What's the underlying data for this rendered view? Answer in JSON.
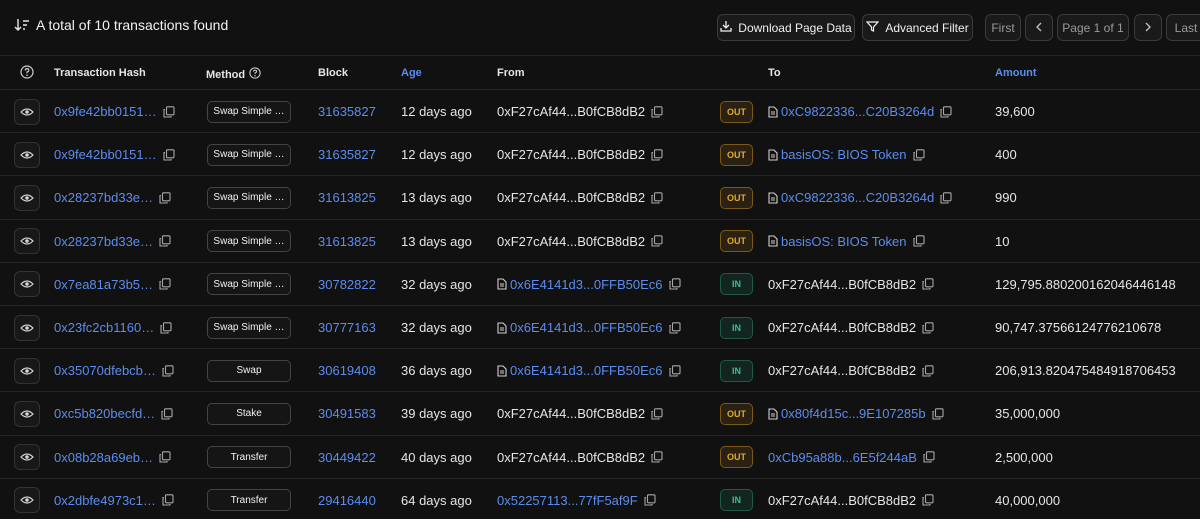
{
  "toolbar": {
    "summary": "A total of 10 transactions found",
    "download_label": "Download Page Data",
    "filter_label": "Advanced Filter",
    "first_label": "First",
    "page_label": "Page 1 of 1",
    "last_label": "Last"
  },
  "columns": {
    "hash": "Transaction Hash",
    "method": "Method",
    "block": "Block",
    "age": "Age",
    "from": "From",
    "to": "To",
    "amount": "Amount"
  },
  "rows": [
    {
      "hash": "0x9fe42bb0151…",
      "method": "Swap Simple …",
      "block": "31635827",
      "age": "12 days ago",
      "from": "0xF27cAf44...B0fCB8dB2",
      "from_contract": false,
      "from_link": false,
      "direction": "OUT",
      "to": "0xC9822336...C20B3264d",
      "to_contract": true,
      "to_link": true,
      "amount": "39,600"
    },
    {
      "hash": "0x9fe42bb0151…",
      "method": "Swap Simple …",
      "block": "31635827",
      "age": "12 days ago",
      "from": "0xF27cAf44...B0fCB8dB2",
      "from_contract": false,
      "from_link": false,
      "direction": "OUT",
      "to": "basisOS: BIOS Token",
      "to_contract": true,
      "to_link": true,
      "amount": "400"
    },
    {
      "hash": "0x28237bd33e…",
      "method": "Swap Simple …",
      "block": "31613825",
      "age": "13 days ago",
      "from": "0xF27cAf44...B0fCB8dB2",
      "from_contract": false,
      "from_link": false,
      "direction": "OUT",
      "to": "0xC9822336...C20B3264d",
      "to_contract": true,
      "to_link": true,
      "amount": "990"
    },
    {
      "hash": "0x28237bd33e…",
      "method": "Swap Simple …",
      "block": "31613825",
      "age": "13 days ago",
      "from": "0xF27cAf44...B0fCB8dB2",
      "from_contract": false,
      "from_link": false,
      "direction": "OUT",
      "to": "basisOS: BIOS Token",
      "to_contract": true,
      "to_link": true,
      "amount": "10"
    },
    {
      "hash": "0x7ea81a73b5…",
      "method": "Swap Simple …",
      "block": "30782822",
      "age": "32 days ago",
      "from": "0x6E4141d3...0FFB50Ec6",
      "from_contract": true,
      "from_link": true,
      "direction": "IN",
      "to": "0xF27cAf44...B0fCB8dB2",
      "to_contract": false,
      "to_link": false,
      "amount": "129,795.880200162046446148"
    },
    {
      "hash": "0x23fc2cb1160…",
      "method": "Swap Simple …",
      "block": "30777163",
      "age": "32 days ago",
      "from": "0x6E4141d3...0FFB50Ec6",
      "from_contract": true,
      "from_link": true,
      "direction": "IN",
      "to": "0xF27cAf44...B0fCB8dB2",
      "to_contract": false,
      "to_link": false,
      "amount": "90,747.37566124776210678"
    },
    {
      "hash": "0x35070dfebcb…",
      "method": "Swap",
      "block": "30619408",
      "age": "36 days ago",
      "from": "0x6E4141d3...0FFB50Ec6",
      "from_contract": true,
      "from_link": true,
      "direction": "IN",
      "to": "0xF27cAf44...B0fCB8dB2",
      "to_contract": false,
      "to_link": false,
      "amount": "206,913.820475484918706453"
    },
    {
      "hash": "0xc5b820becfd…",
      "method": "Stake",
      "block": "30491583",
      "age": "39 days ago",
      "from": "0xF27cAf44...B0fCB8dB2",
      "from_contract": false,
      "from_link": false,
      "direction": "OUT",
      "to": "0x80f4d15c...9E107285b",
      "to_contract": true,
      "to_link": true,
      "amount": "35,000,000"
    },
    {
      "hash": "0x08b28a69eb…",
      "method": "Transfer",
      "block": "30449422",
      "age": "40 days ago",
      "from": "0xF27cAf44...B0fCB8dB2",
      "from_contract": false,
      "from_link": false,
      "direction": "OUT",
      "to": "0xCb95a88b...6E5f244aB",
      "to_contract": false,
      "to_link": true,
      "amount": "2,500,000"
    },
    {
      "hash": "0x2dbfe4973c1…",
      "method": "Transfer",
      "block": "29416440",
      "age": "64 days ago",
      "from": "0x52257113...77fF5af9F",
      "from_contract": false,
      "from_link": true,
      "direction": "IN",
      "to": "0xF27cAf44...B0fCB8dB2",
      "to_contract": false,
      "to_link": false,
      "amount": "40,000,000"
    }
  ],
  "colors": {
    "background": "#111111",
    "link": "#5b8def",
    "out_badge": "#e3a92b",
    "in_badge": "#3bbf8e"
  },
  "icons": {
    "sort": "sort-descending-icon",
    "download": "download-icon",
    "filter": "filter-icon",
    "eye": "eye-icon",
    "copy": "copy-icon",
    "contract": "document-icon",
    "help": "question-circle-icon"
  }
}
